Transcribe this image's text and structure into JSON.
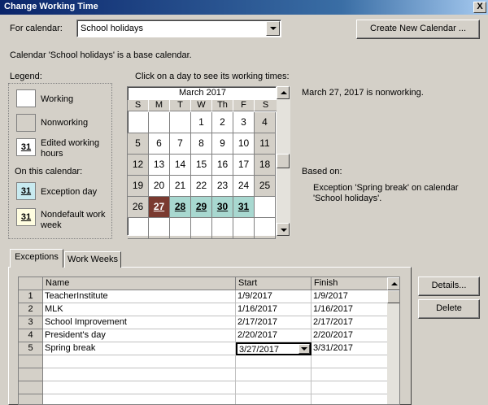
{
  "window": {
    "title": "Change Working Time",
    "close_glyph": "X"
  },
  "for_calendar": {
    "label": "For calendar:",
    "value": "School holidays"
  },
  "create_calendar_button": "Create New Calendar ...",
  "base_calendar_note": "Calendar 'School holidays' is a base calendar.",
  "legend": {
    "title": "Legend:",
    "items": [
      {
        "label": "Working",
        "swatch": "#ffffff"
      },
      {
        "label": "Nonworking",
        "swatch": "#d4d0c8"
      },
      {
        "label": "Edited working hours",
        "swatch": "#ffffff",
        "number": "31"
      }
    ],
    "on_this_calendar": "On this calendar:",
    "calendar_items": [
      {
        "label": "Exception day",
        "swatch": "#c8eaf0",
        "number": "31"
      },
      {
        "label": "Nondefault work week",
        "swatch": "#fffde0",
        "number": "31"
      }
    ]
  },
  "calendar": {
    "instruction": "Click on a day to see its working times:",
    "month": "March 2017",
    "weekdays": [
      "S",
      "M",
      "T",
      "W",
      "Th",
      "F",
      "S"
    ],
    "weeks": [
      [
        {
          "d": ""
        },
        {
          "d": ""
        },
        {
          "d": ""
        },
        {
          "d": "1"
        },
        {
          "d": "2"
        },
        {
          "d": "3"
        },
        {
          "d": "4",
          "t": "non"
        }
      ],
      [
        {
          "d": "5",
          "t": "non"
        },
        {
          "d": "6"
        },
        {
          "d": "7"
        },
        {
          "d": "8"
        },
        {
          "d": "9"
        },
        {
          "d": "10"
        },
        {
          "d": "11",
          "t": "non"
        }
      ],
      [
        {
          "d": "12",
          "t": "non"
        },
        {
          "d": "13"
        },
        {
          "d": "14"
        },
        {
          "d": "15"
        },
        {
          "d": "16"
        },
        {
          "d": "17"
        },
        {
          "d": "18",
          "t": "non"
        }
      ],
      [
        {
          "d": "19",
          "t": "non"
        },
        {
          "d": "20"
        },
        {
          "d": "21"
        },
        {
          "d": "22"
        },
        {
          "d": "23"
        },
        {
          "d": "24"
        },
        {
          "d": "25",
          "t": "non"
        }
      ],
      [
        {
          "d": "26",
          "t": "non"
        },
        {
          "d": "27",
          "t": "sel"
        },
        {
          "d": "28",
          "t": "exc"
        },
        {
          "d": "29",
          "t": "exc"
        },
        {
          "d": "30",
          "t": "exc"
        },
        {
          "d": "31",
          "t": "exc"
        },
        {
          "d": ""
        }
      ],
      [
        {
          "d": ""
        },
        {
          "d": ""
        },
        {
          "d": ""
        },
        {
          "d": ""
        },
        {
          "d": ""
        },
        {
          "d": ""
        },
        {
          "d": ""
        }
      ]
    ]
  },
  "day_info": "March 27, 2017 is nonworking.",
  "based_on": {
    "label": "Based on:",
    "text": "Exception 'Spring break' on calendar 'School holidays'."
  },
  "tabs": [
    {
      "label": "Exceptions",
      "active": true
    },
    {
      "label": "Work Weeks",
      "active": false
    }
  ],
  "exceptions_table": {
    "columns": [
      "Name",
      "Start",
      "Finish"
    ],
    "rows": [
      {
        "n": "1",
        "name": "TeacherInstitute",
        "start": "1/9/2017",
        "finish": "1/9/2017"
      },
      {
        "n": "2",
        "name": "MLK",
        "start": "1/16/2017",
        "finish": "1/16/2017"
      },
      {
        "n": "3",
        "name": "School Improvement",
        "start": "2/17/2017",
        "finish": "2/17/2017"
      },
      {
        "n": "4",
        "name": "President's day",
        "start": "2/20/2017",
        "finish": "2/20/2017"
      },
      {
        "n": "5",
        "name": "Spring break",
        "start": "3/27/2017",
        "finish": "3/31/2017",
        "editing": "start"
      }
    ]
  },
  "details_button": "Details...",
  "delete_button": "Delete"
}
